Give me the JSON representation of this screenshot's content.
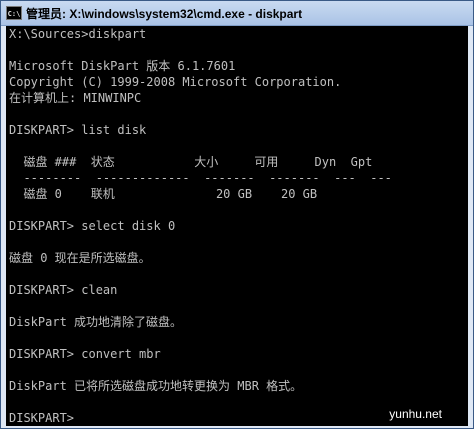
{
  "window": {
    "title": "管理员: X:\\windows\\system32\\cmd.exe - diskpart",
    "icon_label": "C:\\"
  },
  "console": {
    "lines": [
      "X:\\Sources>diskpart",
      "",
      "Microsoft DiskPart 版本 6.1.7601",
      "Copyright (C) 1999-2008 Microsoft Corporation.",
      "在计算机上: MINWINPC",
      "",
      "DISKPART> list disk",
      "",
      "  磁盘 ###  状态           大小     可用     Dyn  Gpt",
      "  --------  -------------  -------  -------  ---  ---",
      "  磁盘 0    联机              20 GB    20 GB",
      "",
      "DISKPART> select disk 0",
      "",
      "磁盘 0 现在是所选磁盘。",
      "",
      "DISKPART> clean",
      "",
      "DiskPart 成功地清除了磁盘。",
      "",
      "DISKPART> convert mbr",
      "",
      "DiskPart 已将所选磁盘成功地转更换为 MBR 格式。",
      "",
      "DISKPART>"
    ]
  },
  "watermark": "yunhu.net"
}
